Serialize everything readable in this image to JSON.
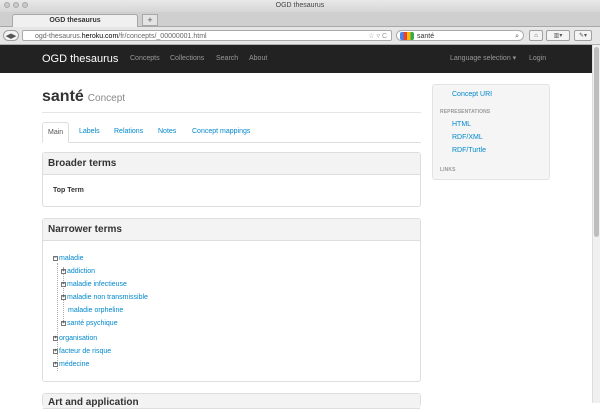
{
  "browser": {
    "window_title": "OGD thesaurus",
    "tab_title": "OGD thesaurus",
    "url_prefix": "ogd-thesaurus.",
    "url_host": "heroku.com",
    "url_path": "/fr/concepts/_00000001.html",
    "search_value": "santé"
  },
  "site": {
    "brand": "OGD thesaurus",
    "nav": [
      "Concepts",
      "Collections",
      "Search",
      "About"
    ],
    "language_selection": "Language selection",
    "login": "Login"
  },
  "concept": {
    "title": "santé",
    "subtitle": "Concept"
  },
  "tabs": [
    "Main",
    "Labels",
    "Relations",
    "Notes",
    "Concept mappings"
  ],
  "broader": {
    "heading": "Broader terms",
    "top_term": "Top Term"
  },
  "narrower": {
    "heading": "Narrower terms",
    "root": "maladie",
    "children": [
      "addiction",
      "maladie infectieuse",
      "maladie non transmissible",
      "maladie orpheline",
      "santé psychique"
    ],
    "siblings": [
      "organisation",
      "facteur de risque",
      "médecine"
    ]
  },
  "next_panel_heading": "Art and application",
  "sidebar": {
    "concept_uri": "Concept URI",
    "representations_heading": "REPRESENTATIONS",
    "representations": [
      "HTML",
      "RDF/XML",
      "RDF/Turtle"
    ],
    "links_heading": "LINKS"
  }
}
